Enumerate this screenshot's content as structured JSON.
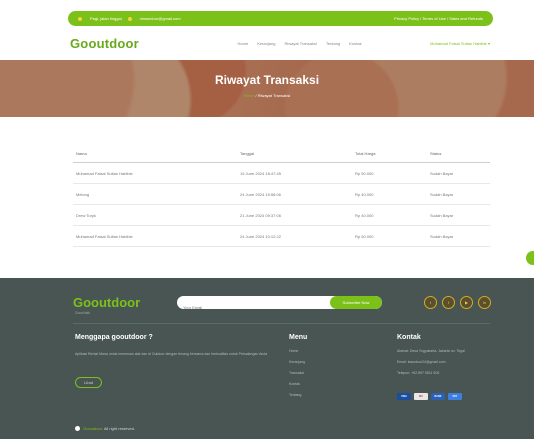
{
  "topbar": {
    "hours": "Pagi, jalan tinggal",
    "email": "nimsedoor@gmail.com",
    "links": "Privacy Policy / Terms of Use / Sales and Refunds"
  },
  "nav": {
    "brand": "Gooutdoor",
    "items": [
      "Home",
      "Keranjang",
      "Riwayat Transaksi",
      "Tentang",
      "Kontak"
    ],
    "user": "Muhamad Faisal Sultan Habibie"
  },
  "hero": {
    "title": "Riwayat Transaksi",
    "crumb_home": "Home",
    "crumb_current": "Riwayat Transaksi"
  },
  "table": {
    "headers": [
      "Nama",
      "Tanggal",
      "Total Harga",
      "Status"
    ],
    "rows": [
      [
        "Muhamad Faisal Sultan Habibie",
        "19 June 2024 18:47:45",
        "Rp 50.000",
        "Sudah Bayar"
      ],
      [
        "Melong",
        "24 June 2024 15:58:06",
        "Rp 40.000",
        "Sudah Bayar"
      ],
      [
        "Drew Toryk",
        "21 June 2024 09:37:06",
        "Rp 40.000",
        "Sudah Bayar"
      ],
      [
        "Muhamad Faisal Sultan Habibie",
        "24 June 2024 10:12:22",
        "Rp 50.000",
        "Sudah Bayar"
      ]
    ]
  },
  "footer": {
    "brand": "Gooutdoor",
    "tagline": "Good talk",
    "subscribe_placeholder": "Your Email",
    "subscribe_button": "Subscribe Now",
    "socials": [
      "twitter-icon",
      "facebook-icon",
      "youtube-icon",
      "linkedin-icon"
    ],
    "why_title": "Menggapa gooutdoor ?",
    "why_text": "Aplikasi Rental Mana untuk memesan alat dan di Outdoor dengan tenang bersama dan berkualitas untuk Petualangan Anda",
    "more_button": "Lihat",
    "menu_title": "Menu",
    "menu_items": [
      "Home",
      "Keranjang",
      "Transaksi",
      "Kontak",
      "Tentang"
    ],
    "contact_title": "Kontak",
    "contact_address": "Alamat: Desa Yogyakarta, Jakarta no. Tegal",
    "contact_email": "Email: kasodoor24@gmail.com",
    "contact_phone": "Telepon: +62 897 5511 505",
    "payments": [
      "VISA",
      "MC",
      "BANK",
      "PAY"
    ],
    "copyright_brand": "Gooutdoor.",
    "copyright_text": "All right reserved."
  },
  "colors": {
    "accent": "#7cc11a",
    "footer_bg": "#485552"
  }
}
